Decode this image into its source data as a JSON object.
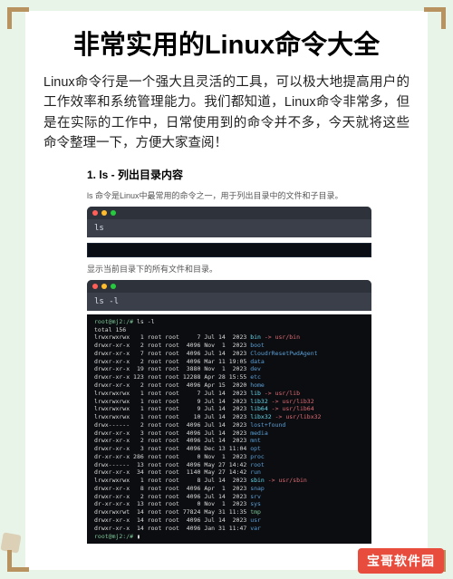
{
  "title": "非常实用的Linux命令大全",
  "intro": "Linux命令行是一个强大且灵活的工具，可以极大地提高用户的工作效率和系统管理能力。我们都知道，Linux命令非常多，但是在实际的工作中，日常使用到的命令并不多，今天就将这些命令整理一下，方便大家查阅！",
  "section1": {
    "heading": "1. ls - 列出目录内容",
    "caption1": "ls 命令是Linux中最常用的命令之一，用于列出目录中的文件和子目录。",
    "cmd1": "ls",
    "caption2": "显示当前目录下的所有文件和目录。",
    "cmd2": "ls -l"
  },
  "output": {
    "prompt": "root@mj2:/#",
    "cmd": "ls -l",
    "total": "total 156",
    "rows": [
      {
        "perm": "lrwxrwxrwx",
        "n": "1",
        "o": "root",
        "g": "root",
        "sz": "7",
        "dt": "Jul 14",
        "yr": "2023",
        "name": "bin",
        "link": " -> usr/bin",
        "cls": "p-cyan"
      },
      {
        "perm": "drwxr-xr-x",
        "n": "2",
        "o": "root",
        "g": "root",
        "sz": "4096",
        "dt": "Nov  1",
        "yr": "2023",
        "name": "boot",
        "link": "",
        "cls": "p-blue"
      },
      {
        "perm": "drwxr-xr-x",
        "n": "7",
        "o": "root",
        "g": "root",
        "sz": "4096",
        "dt": "Jul 14",
        "yr": "2023",
        "name": "CloudrResetPwdAgent",
        "link": "",
        "cls": "p-blue"
      },
      {
        "perm": "drwxr-xr-x",
        "n": "2",
        "o": "root",
        "g": "root",
        "sz": "4096",
        "dt": "Mar 11",
        "yr": "19:05",
        "name": "data",
        "link": "",
        "cls": "p-blue"
      },
      {
        "perm": "drwxr-xr-x",
        "n": "19",
        "o": "root",
        "g": "root",
        "sz": "3880",
        "dt": "Nov  1",
        "yr": "2023",
        "name": "dev",
        "link": "",
        "cls": "p-blue"
      },
      {
        "perm": "drwxr-xr-x",
        "n": "123",
        "o": "root",
        "g": "root",
        "sz": "12288",
        "dt": "Apr 28",
        "yr": "15:55",
        "name": "etc",
        "link": "",
        "cls": "p-blue"
      },
      {
        "perm": "drwxr-xr-x",
        "n": "2",
        "o": "root",
        "g": "root",
        "sz": "4096",
        "dt": "Apr 15",
        "yr": "2020",
        "name": "home",
        "link": "",
        "cls": "p-blue"
      },
      {
        "perm": "lrwxrwxrwx",
        "n": "1",
        "o": "root",
        "g": "root",
        "sz": "7",
        "dt": "Jul 14",
        "yr": "2023",
        "name": "lib",
        "link": " -> usr/lib",
        "cls": "p-cyan"
      },
      {
        "perm": "lrwxrwxrwx",
        "n": "1",
        "o": "root",
        "g": "root",
        "sz": "9",
        "dt": "Jul 14",
        "yr": "2023",
        "name": "lib32",
        "link": " -> usr/lib32",
        "cls": "p-cyan"
      },
      {
        "perm": "lrwxrwxrwx",
        "n": "1",
        "o": "root",
        "g": "root",
        "sz": "9",
        "dt": "Jul 14",
        "yr": "2023",
        "name": "lib64",
        "link": " -> usr/lib64",
        "cls": "p-cyan"
      },
      {
        "perm": "lrwxrwxrwx",
        "n": "1",
        "o": "root",
        "g": "root",
        "sz": "10",
        "dt": "Jul 14",
        "yr": "2023",
        "name": "libx32",
        "link": " -> usr/libx32",
        "cls": "p-cyan"
      },
      {
        "perm": "drwx------",
        "n": "2",
        "o": "root",
        "g": "root",
        "sz": "4096",
        "dt": "Jul 14",
        "yr": "2023",
        "name": "lost+found",
        "link": "",
        "cls": "p-blue"
      },
      {
        "perm": "drwxr-xr-x",
        "n": "3",
        "o": "root",
        "g": "root",
        "sz": "4096",
        "dt": "Jul 14",
        "yr": "2023",
        "name": "media",
        "link": "",
        "cls": "p-blue"
      },
      {
        "perm": "drwxr-xr-x",
        "n": "2",
        "o": "root",
        "g": "root",
        "sz": "4096",
        "dt": "Jul 14",
        "yr": "2023",
        "name": "mnt",
        "link": "",
        "cls": "p-blue"
      },
      {
        "perm": "drwxr-xr-x",
        "n": "3",
        "o": "root",
        "g": "root",
        "sz": "4096",
        "dt": "Dec 13",
        "yr": "11:04",
        "name": "opt",
        "link": "",
        "cls": "p-blue"
      },
      {
        "perm": "dr-xr-xr-x",
        "n": "286",
        "o": "root",
        "g": "root",
        "sz": "0",
        "dt": "Nov  1",
        "yr": "2023",
        "name": "proc",
        "link": "",
        "cls": "p-blue"
      },
      {
        "perm": "drwx------",
        "n": "13",
        "o": "root",
        "g": "root",
        "sz": "4096",
        "dt": "May 27",
        "yr": "14:42",
        "name": "root",
        "link": "",
        "cls": "p-blue"
      },
      {
        "perm": "drwxr-xr-x",
        "n": "34",
        "o": "root",
        "g": "root",
        "sz": "1140",
        "dt": "May 27",
        "yr": "14:42",
        "name": "run",
        "link": "",
        "cls": "p-blue"
      },
      {
        "perm": "lrwxrwxrwx",
        "n": "1",
        "o": "root",
        "g": "root",
        "sz": "8",
        "dt": "Jul 14",
        "yr": "2023",
        "name": "sbin",
        "link": " -> usr/sbin",
        "cls": "p-cyan"
      },
      {
        "perm": "drwxr-xr-x",
        "n": "8",
        "o": "root",
        "g": "root",
        "sz": "4096",
        "dt": "Apr  1",
        "yr": "2023",
        "name": "snap",
        "link": "",
        "cls": "p-blue"
      },
      {
        "perm": "drwxr-xr-x",
        "n": "2",
        "o": "root",
        "g": "root",
        "sz": "4096",
        "dt": "Jul 14",
        "yr": "2023",
        "name": "srv",
        "link": "",
        "cls": "p-blue"
      },
      {
        "perm": "dr-xr-xr-x",
        "n": "13",
        "o": "root",
        "g": "root",
        "sz": "0",
        "dt": "Nov  1",
        "yr": "2023",
        "name": "sys",
        "link": "",
        "cls": "p-blue"
      },
      {
        "perm": "drwxrwxrwt",
        "n": "14",
        "o": "root",
        "g": "root",
        "sz": "77824",
        "dt": "May 31",
        "yr": "11:35",
        "name": "tmp",
        "link": "",
        "cls": "p-green"
      },
      {
        "perm": "drwxr-xr-x",
        "n": "14",
        "o": "root",
        "g": "root",
        "sz": "4096",
        "dt": "Jul 14",
        "yr": "2023",
        "name": "usr",
        "link": "",
        "cls": "p-blue"
      },
      {
        "perm": "drwxr-xr-x",
        "n": "14",
        "o": "root",
        "g": "root",
        "sz": "4096",
        "dt": "Jan 31",
        "yr": "11:47",
        "name": "var",
        "link": "",
        "cls": "p-blue"
      }
    ],
    "endprompt": "root@mj2:/# "
  },
  "badge": "宝哥软件园"
}
